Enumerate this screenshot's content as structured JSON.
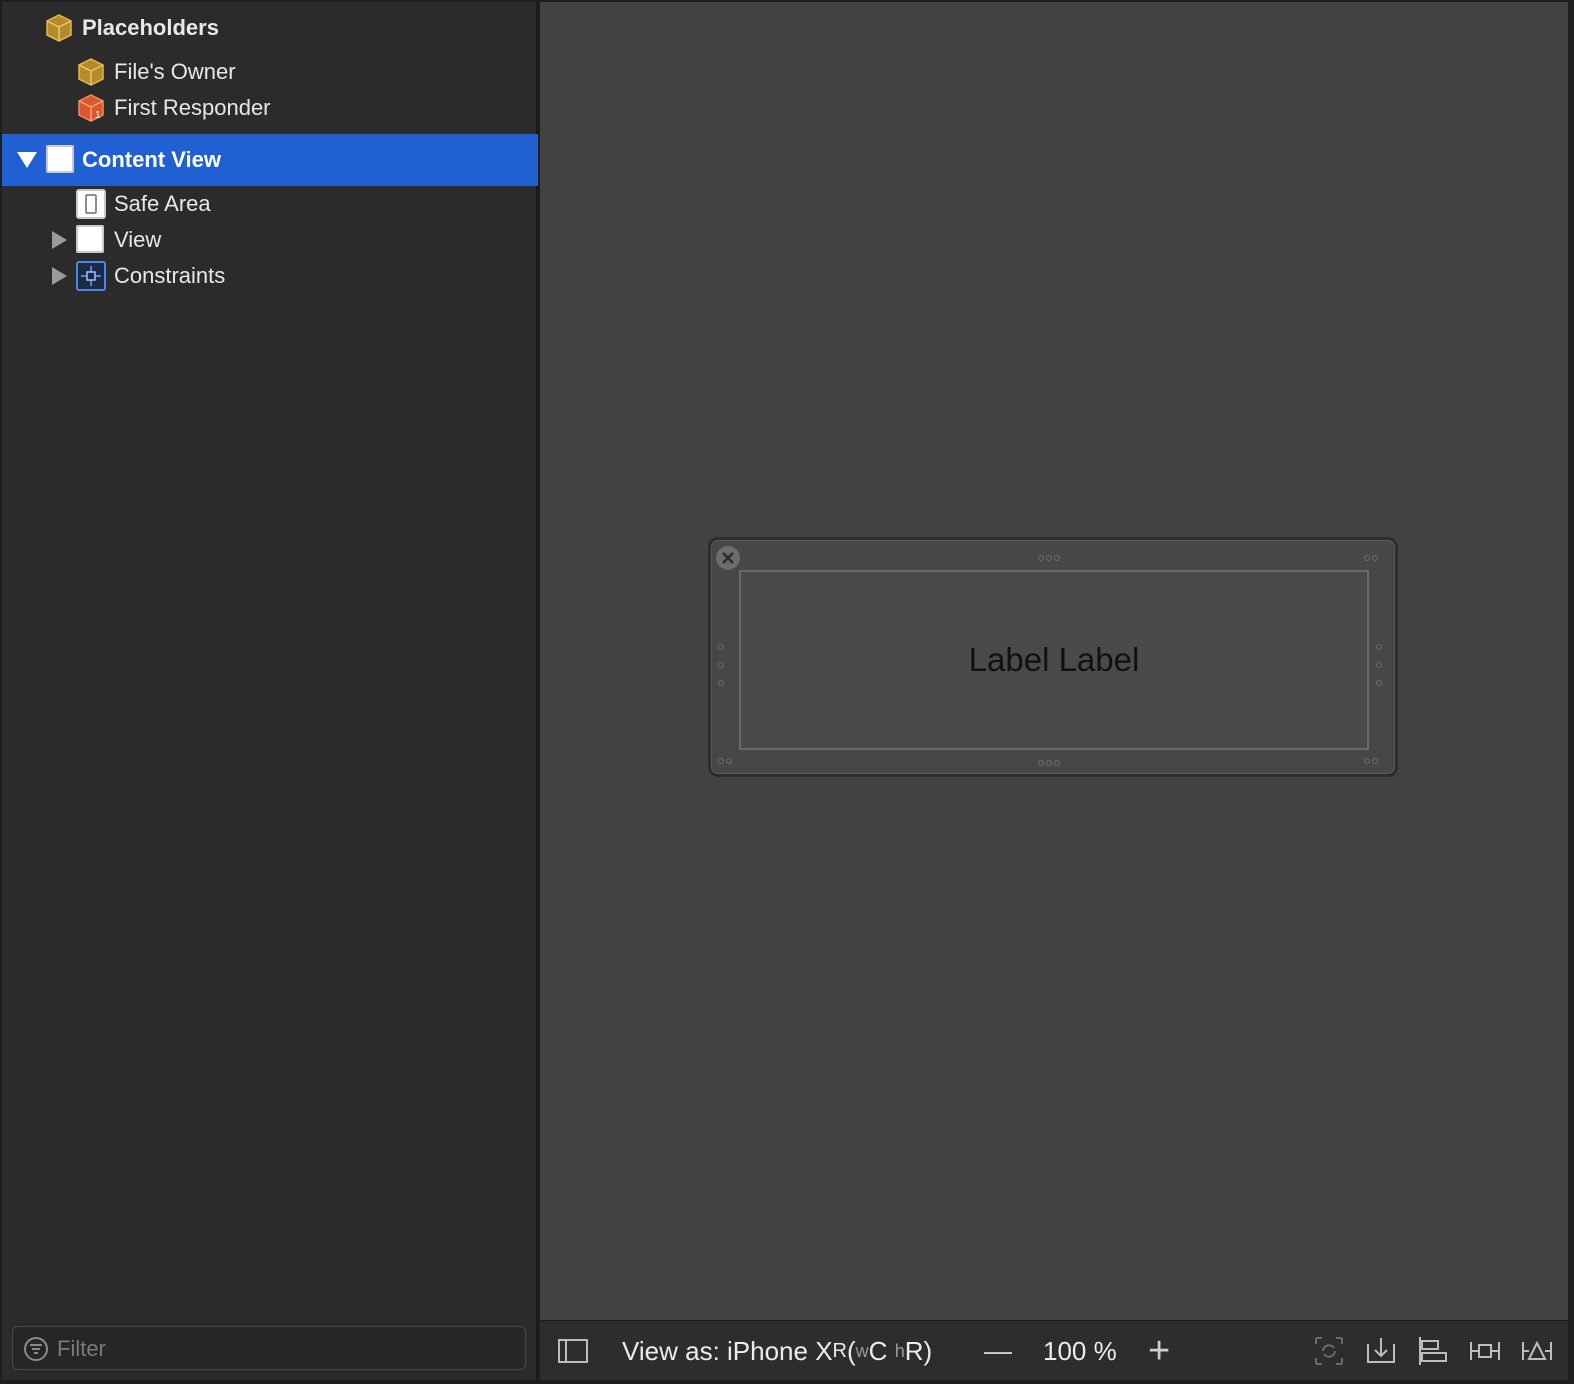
{
  "outline": {
    "placeholders_label": "Placeholders",
    "files_owner_label": "File's Owner",
    "first_responder_label": "First Responder",
    "content_view_label": "Content View",
    "safe_area_label": "Safe Area",
    "view_label": "View",
    "constraints_label": "Constraints"
  },
  "filter": {
    "placeholder": "Filter",
    "value": ""
  },
  "canvas": {
    "label_text": "Label Label"
  },
  "bottom_bar": {
    "view_as_prefix": "View as: iPhone X",
    "view_as_model_suffix": "R",
    "view_as_paren_open": " (",
    "width_class_prefix": "w",
    "width_class": "C",
    "height_class_prefix": "h",
    "height_class": "R",
    "view_as_paren_close": ")",
    "zoom_out_symbol": "—",
    "zoom_level": "100 %",
    "zoom_in_symbol": "+"
  },
  "colors": {
    "selection": "#2160d3",
    "sidebar_bg": "#2b2b2b",
    "canvas_bg": "#424242",
    "cube_yellow": "#c9a13a",
    "cube_orange": "#e06a3c"
  },
  "icons": {
    "placeholders": "cube-icon",
    "files_owner": "cube-icon",
    "first_responder": "responder-cube-icon",
    "content_view": "view-icon",
    "safe_area": "safe-area-icon",
    "view": "view-icon",
    "constraints": "constraints-icon"
  }
}
